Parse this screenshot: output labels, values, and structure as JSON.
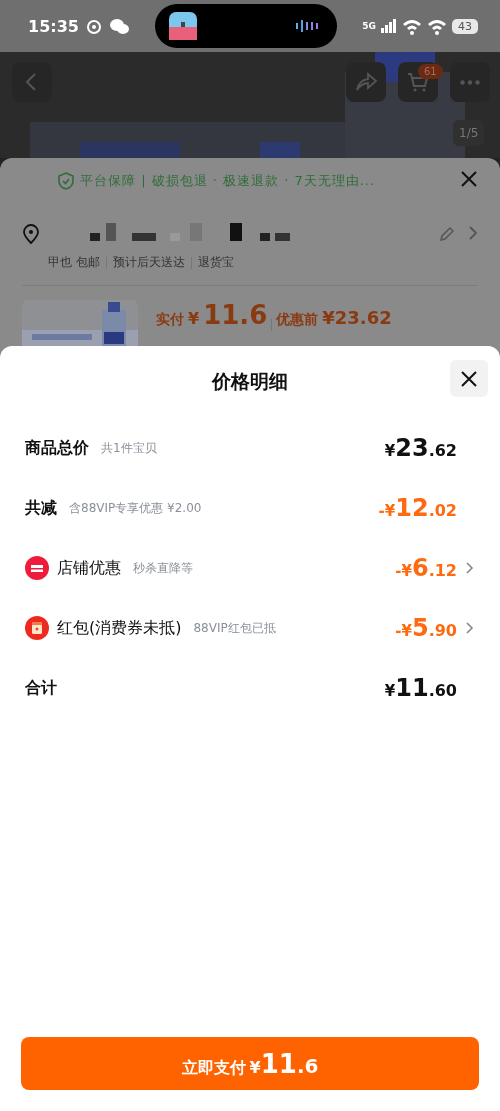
{
  "status_bar": {
    "time": "15:35",
    "network": "5G",
    "battery": "43"
  },
  "background": {
    "cart_badge": "61",
    "image_counter": "1/5",
    "guarantee": "平台保障 | 破损包退 · 极速退款 · 7天无理由...",
    "delivery_tags": [
      "甲也 包邮",
      "预计后天送达",
      "退货宝"
    ],
    "paid_label": "实付",
    "paid_currency": "¥",
    "paid_amount": "11.6",
    "before_label": "优惠前",
    "before_amount": "¥23.62"
  },
  "sheet": {
    "title": "价格明细",
    "rows": [
      {
        "kind": "subtotal",
        "label": "商品总价",
        "note": "共1件宝贝",
        "prefix": "¥",
        "integer": "23",
        "fraction": ".62",
        "chevron": false
      },
      {
        "kind": "reduction",
        "label": "共减",
        "note": "含88VIP专享优惠 ¥2.00",
        "prefix": "-¥",
        "integer": "12",
        "fraction": ".02",
        "chevron": false
      },
      {
        "kind": "shop",
        "label": "店铺优惠",
        "note": "秒杀直降等",
        "prefix": "-¥",
        "integer": "6",
        "fraction": ".12",
        "chevron": true
      },
      {
        "kind": "coupon",
        "label": "红包(消费券未抵)",
        "note": "88VIP红包已抵",
        "prefix": "-¥",
        "integer": "5",
        "fraction": ".90",
        "chevron": true
      },
      {
        "kind": "total",
        "label": "合计",
        "prefix": "¥",
        "integer": "11",
        "fraction": ".60",
        "chevron": false
      }
    ],
    "pay_button": {
      "label": "立即支付",
      "prefix": "¥",
      "integer": "11",
      "fraction": ".6"
    }
  }
}
